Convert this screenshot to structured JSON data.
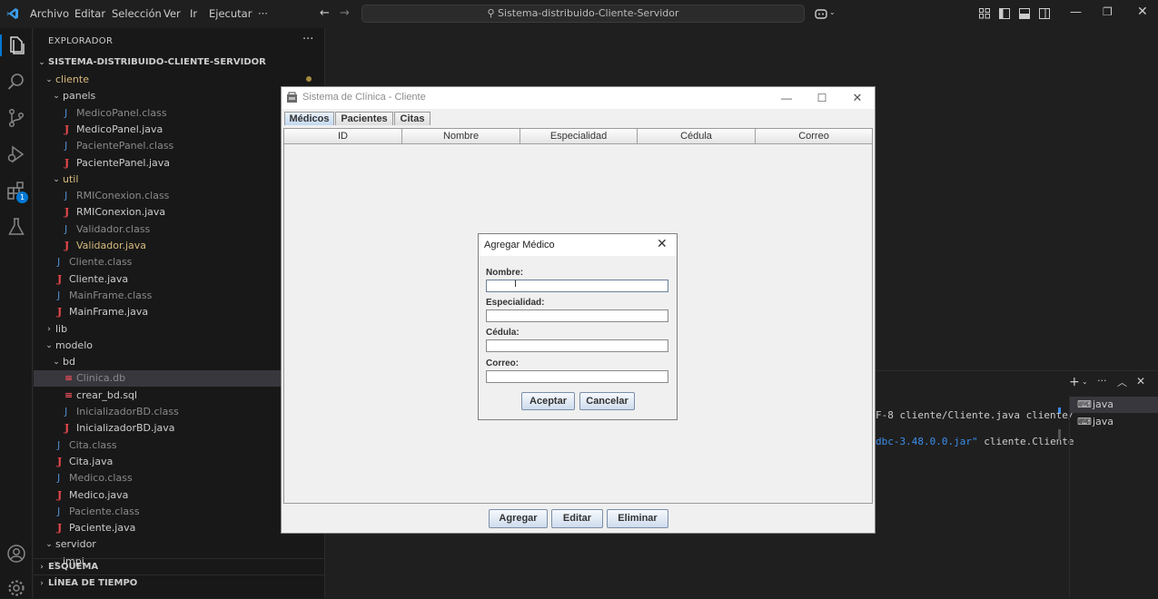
{
  "titlebar": {
    "menu": [
      "Archivo",
      "Editar",
      "Selección",
      "Ver",
      "Ir",
      "Ejecutar"
    ],
    "more": "···",
    "search": "Sistema-distribuido-Cliente-Servidor"
  },
  "explorer": {
    "header": "EXPLORADOR",
    "more": "···",
    "project": "SISTEMA-DISTRIBUIDO-CLIENTE-SERVIDOR",
    "items": [
      {
        "label": "cliente",
        "kind": "folder"
      },
      {
        "label": "panels",
        "kind": "folder"
      },
      {
        "label": "MedicoPanel.class",
        "kind": "class"
      },
      {
        "label": "MedicoPanel.java",
        "kind": "java"
      },
      {
        "label": "PacientePanel.class",
        "kind": "class"
      },
      {
        "label": "PacientePanel.java",
        "kind": "java"
      },
      {
        "label": "util",
        "kind": "folder"
      },
      {
        "label": "RMIConexion.class",
        "kind": "class"
      },
      {
        "label": "RMIConexion.java",
        "kind": "java"
      },
      {
        "label": "Validador.class",
        "kind": "class"
      },
      {
        "label": "Validador.java",
        "kind": "java"
      },
      {
        "label": "Cliente.class",
        "kind": "class"
      },
      {
        "label": "Cliente.java",
        "kind": "java"
      },
      {
        "label": "MainFrame.class",
        "kind": "class"
      },
      {
        "label": "MainFrame.java",
        "kind": "java"
      },
      {
        "label": "lib",
        "kind": "folder"
      },
      {
        "label": "modelo",
        "kind": "folder"
      },
      {
        "label": "bd",
        "kind": "folder"
      },
      {
        "label": "Clinica.db",
        "kind": "db"
      },
      {
        "label": "crear_bd.sql",
        "kind": "db"
      },
      {
        "label": "InicializadorBD.class",
        "kind": "class"
      },
      {
        "label": "InicializadorBD.java",
        "kind": "java"
      },
      {
        "label": "Cita.class",
        "kind": "class"
      },
      {
        "label": "Cita.java",
        "kind": "java"
      },
      {
        "label": "Medico.class",
        "kind": "class"
      },
      {
        "label": "Medico.java",
        "kind": "java"
      },
      {
        "label": "Paciente.class",
        "kind": "class"
      },
      {
        "label": "Paciente.java",
        "kind": "java"
      },
      {
        "label": "servidor",
        "kind": "folder"
      },
      {
        "label": "impl",
        "kind": "folder"
      }
    ],
    "sections": [
      "ESQUEMA",
      "LÍNEA DE TIEMPO"
    ]
  },
  "activity": {
    "extensions_badge": "1"
  },
  "terminal": {
    "line1": "F-8 cliente/Cliente.java cliente/",
    "line2_link": "dbc-3.48.0.0.jar\"",
    "line2_rest": " cliente.Cliente",
    "tabs": [
      "java",
      "java"
    ]
  },
  "swing": {
    "title": "Sistema de Clínica - Cliente",
    "tabs": [
      "Médicos",
      "Pacientes",
      "Citas"
    ],
    "columns": [
      "ID",
      "Nombre",
      "Especialidad",
      "Cédula",
      "Correo"
    ],
    "buttons": {
      "add": "Agregar",
      "edit": "Editar",
      "delete": "Eliminar"
    }
  },
  "dialog": {
    "title": "Agregar Médico",
    "fields": [
      {
        "label": "Nombre:",
        "value": ""
      },
      {
        "label": "Especialidad:",
        "value": ""
      },
      {
        "label": "Cédula:",
        "value": ""
      },
      {
        "label": "Correo:",
        "value": ""
      }
    ],
    "accept": "Aceptar",
    "cancel": "Cancelar"
  }
}
